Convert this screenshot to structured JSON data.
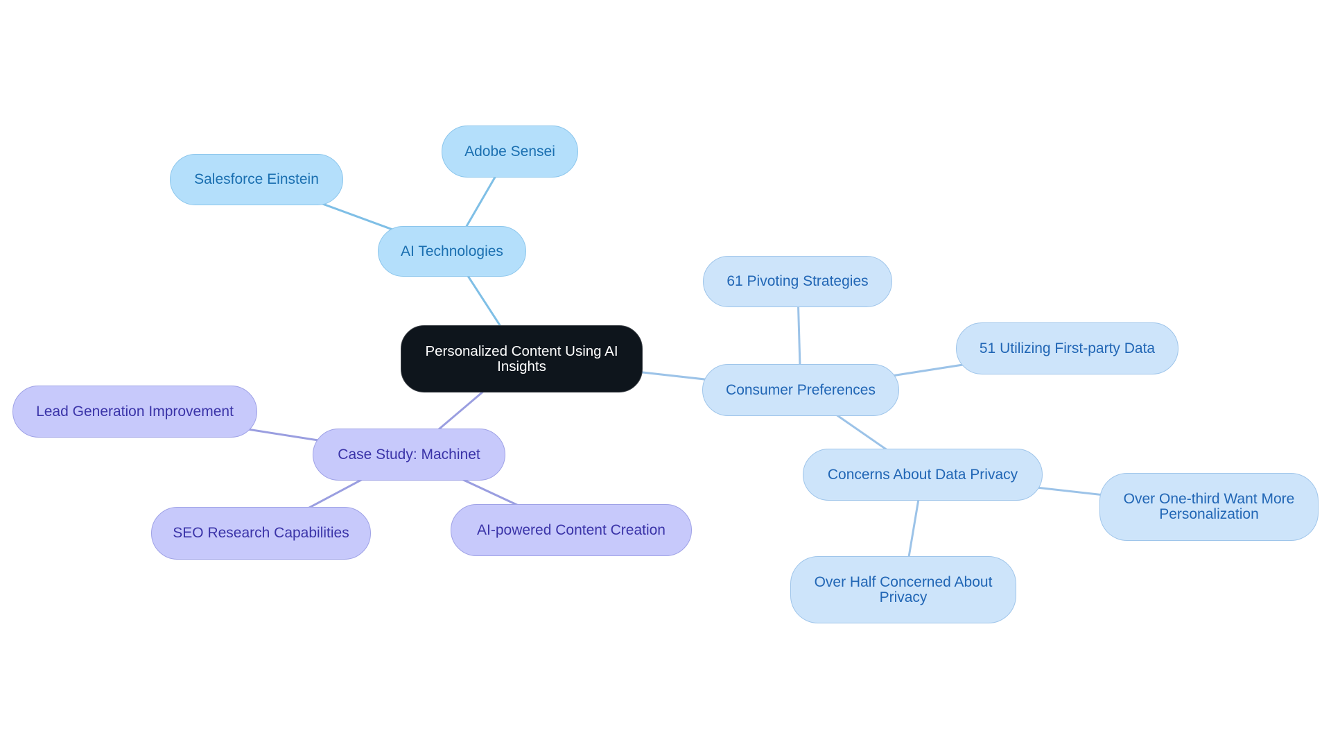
{
  "diagram": {
    "type": "mind-map",
    "colors": {
      "root_fill": "#0e151c",
      "root_text": "#ffffff",
      "ai_branch_fill": "#b4dffb",
      "ai_branch_text": "#1a6fb0",
      "ai_branch_edge": "#7fbfe6",
      "consumer_branch_fill": "#cde4fa",
      "consumer_branch_text": "#2166b5",
      "consumer_branch_edge": "#9cc3e8",
      "case_branch_fill": "#c7c9fb",
      "case_branch_text": "#3a33a8",
      "case_branch_edge": "#9a9ee0"
    },
    "root": {
      "id": "root",
      "label": "Personalized Content Using AI Insights"
    },
    "nodes": [
      {
        "id": "ai-tech",
        "label": "AI Technologies",
        "parent": "root",
        "branch": "blue"
      },
      {
        "id": "adobe",
        "label": "Adobe Sensei",
        "parent": "ai-tech",
        "branch": "blue"
      },
      {
        "id": "salesforce",
        "label": "Salesforce Einstein",
        "parent": "ai-tech",
        "branch": "blue"
      },
      {
        "id": "consumer",
        "label": "Consumer Preferences",
        "parent": "root",
        "branch": "light"
      },
      {
        "id": "pivot",
        "label": "61 Pivoting Strategies",
        "parent": "consumer",
        "branch": "light"
      },
      {
        "id": "firstparty",
        "label": "51 Utilizing First-party Data",
        "parent": "consumer",
        "branch": "light"
      },
      {
        "id": "privacy",
        "label": "Concerns About Data Privacy",
        "parent": "consumer",
        "branch": "light"
      },
      {
        "id": "onethird",
        "label": "Over One-third Want More Personalization",
        "parent": "privacy",
        "branch": "light"
      },
      {
        "id": "overhalf",
        "label": "Over Half Concerned About Privacy",
        "parent": "privacy",
        "branch": "light"
      },
      {
        "id": "case",
        "label": "Case Study: Machinet",
        "parent": "root",
        "branch": "purple"
      },
      {
        "id": "leadgen",
        "label": "Lead Generation Improvement",
        "parent": "case",
        "branch": "purple"
      },
      {
        "id": "seo",
        "label": "SEO Research Capabilities",
        "parent": "case",
        "branch": "purple"
      },
      {
        "id": "aicontent",
        "label": "AI-powered Content Creation",
        "parent": "case",
        "branch": "purple"
      }
    ]
  }
}
